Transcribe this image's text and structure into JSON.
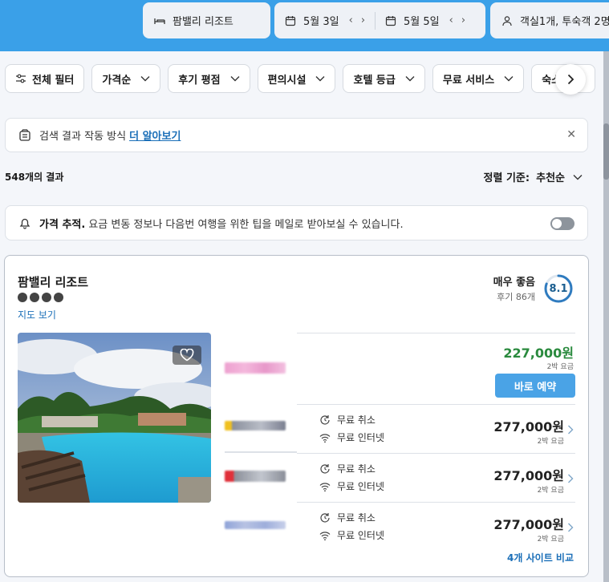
{
  "search": {
    "destination": "팜밸리 리조트",
    "checkin": "5월 3일",
    "checkout": "5월 5일",
    "guests": "객실1개, 투숙객 2명"
  },
  "filters": {
    "all": "전체 필터",
    "items": [
      "가격순",
      "후기 평점",
      "편의시설",
      "호텔 등급",
      "무료 서비스",
      "숙소"
    ]
  },
  "info": {
    "text": "검색 결과 작동 방식",
    "link": "더 알아보기"
  },
  "results": {
    "count": "548개의 결과",
    "sort_label": "정렬 기준:",
    "sort_value": "추천순"
  },
  "price_alert": {
    "title": "가격 추적.",
    "text": "요금 변동 정보나 다음번 여행을 위한 팁을 메일로 받아보실 수 있습니다."
  },
  "hotel": {
    "name": "팜밸리 리조트",
    "stars": 4,
    "map_link": "지도 보기",
    "rating_text": "매우 좋음",
    "review_count": "후기 86개",
    "score": "8.1",
    "score_fraction": 0.81,
    "featured": {
      "price": "227,000원",
      "sub": "2박 요금",
      "book": "바로 예약"
    },
    "offers": [
      {
        "free_cancel": "무료 취소",
        "free_internet": "무료 인터넷",
        "price": "277,000원",
        "sub": "2박 요금"
      },
      {
        "free_cancel": "무료 취소",
        "free_internet": "무료 인터넷",
        "price": "277,000원",
        "sub": "2박 요금"
      },
      {
        "free_cancel": "무료 취소",
        "free_internet": "무료 인터넷",
        "price": "277,000원",
        "sub": "2박 요금"
      }
    ],
    "compare": "4개 사이트 비교"
  },
  "colors": {
    "header": "#3aa0e8",
    "accent": "#1b6fb8",
    "price_green": "#2a8a3e",
    "book_button": "#4aa3e6"
  }
}
